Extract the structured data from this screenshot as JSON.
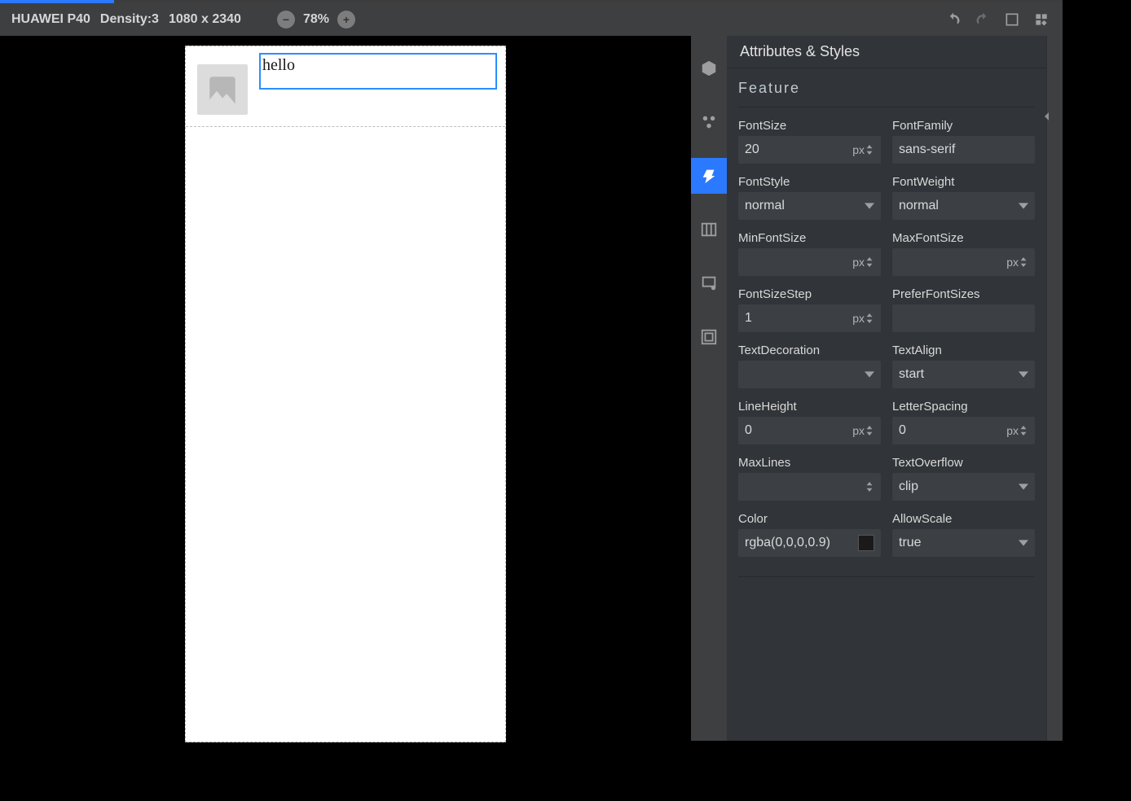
{
  "toolbar": {
    "device": "HUAWEI P40",
    "density_label": "Density:3",
    "resolution": "1080 x 2340",
    "zoom": "78%"
  },
  "preview": {
    "text_value": "hello"
  },
  "panel": {
    "title": "Attributes & Styles",
    "section": "Feature",
    "fields": {
      "fontSize": {
        "label": "FontSize",
        "value": "20",
        "unit": "px",
        "kind": "stepper"
      },
      "fontFamily": {
        "label": "FontFamily",
        "value": "sans-serif",
        "kind": "text"
      },
      "fontStyle": {
        "label": "FontStyle",
        "value": "normal",
        "kind": "select"
      },
      "fontWeight": {
        "label": "FontWeight",
        "value": "normal",
        "kind": "select"
      },
      "minFontSize": {
        "label": "MinFontSize",
        "value": "",
        "unit": "px",
        "kind": "stepper"
      },
      "maxFontSize": {
        "label": "MaxFontSize",
        "value": "",
        "unit": "px",
        "kind": "stepper"
      },
      "fontSizeStep": {
        "label": "FontSizeStep",
        "value": "1",
        "unit": "px",
        "kind": "stepper"
      },
      "preferFontSizes": {
        "label": "PreferFontSizes",
        "value": "",
        "kind": "text"
      },
      "textDecoration": {
        "label": "TextDecoration",
        "value": "",
        "kind": "select"
      },
      "textAlign": {
        "label": "TextAlign",
        "value": "start",
        "kind": "select"
      },
      "lineHeight": {
        "label": "LineHeight",
        "value": "0",
        "unit": "px",
        "kind": "stepper"
      },
      "letterSpacing": {
        "label": "LetterSpacing",
        "value": "0",
        "unit": "px",
        "kind": "stepper"
      },
      "maxLines": {
        "label": "MaxLines",
        "value": "",
        "kind": "stepper"
      },
      "textOverflow": {
        "label": "TextOverflow",
        "value": "clip",
        "kind": "select"
      },
      "color": {
        "label": "Color",
        "value": "rgba(0,0,0,0.9)",
        "kind": "color"
      },
      "allowScale": {
        "label": "AllowScale",
        "value": "true",
        "kind": "select"
      }
    }
  }
}
